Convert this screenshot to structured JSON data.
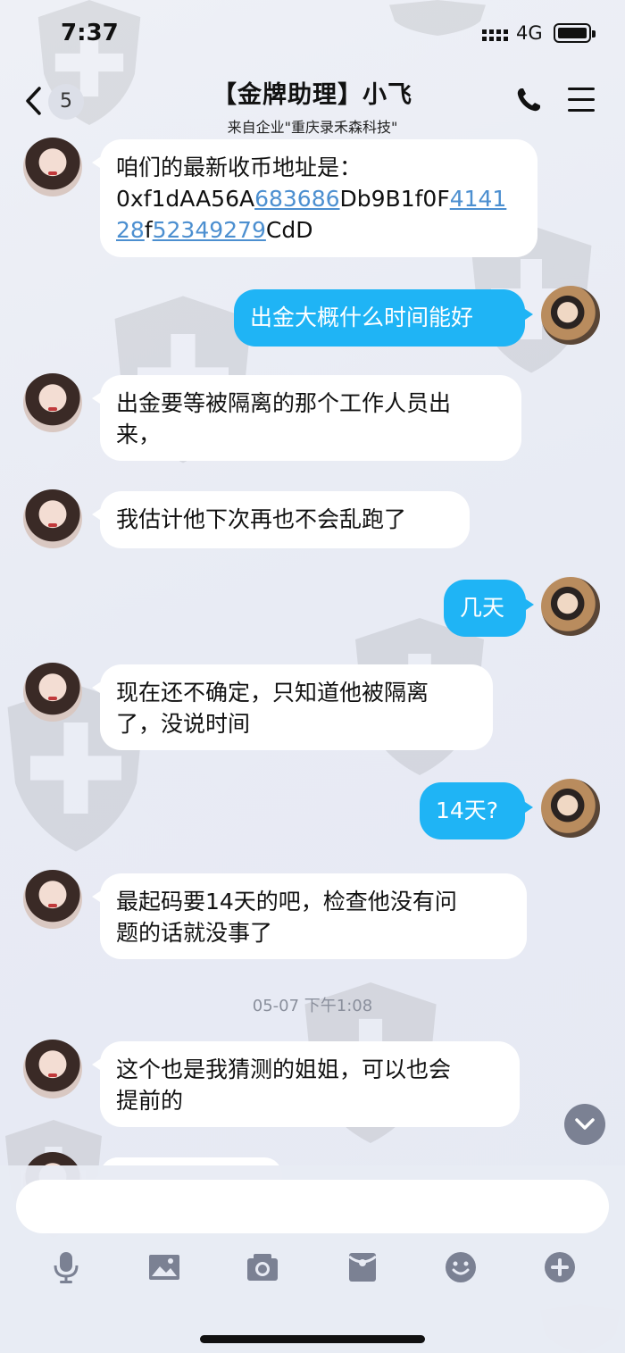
{
  "status_bar": {
    "time": "7:37",
    "network": "4G"
  },
  "header": {
    "unread_count": "5",
    "title": "【金牌助理】小飞",
    "subtitle": "来自企业\"重庆录禾森科技\""
  },
  "messages": [
    {
      "side": "in",
      "text_lines": [
        "咱们的最新收币地址是：",
        "",
        ""
      ],
      "address": {
        "p1": "0xf1dAA56A",
        "p2": "683686",
        "p3": "Db9B1f0F",
        "p4": "4141",
        "p5": "28",
        "p6": "f",
        "p7": "52349279",
        "p8": "CdD"
      }
    },
    {
      "side": "out",
      "text": "出金大概什么时间能好"
    },
    {
      "side": "in",
      "text_lines": [
        "出金要等被隔离的那个工作人员出",
        "来，"
      ]
    },
    {
      "side": "in",
      "text": "我估计他下次再也不会乱跑了"
    },
    {
      "side": "out",
      "text": "几天"
    },
    {
      "side": "in",
      "text_lines": [
        "现在还不确定，只知道他被隔离",
        "了，没说时间"
      ]
    },
    {
      "side": "out",
      "text": "14天?"
    },
    {
      "side": "in",
      "text_lines": [
        "最起码要14天的吧，检查他没有问",
        "题的话就没事了"
      ]
    },
    {
      "side": "in",
      "text_lines": [
        "这个也是我猜测的姐姐，可以也会",
        "提前的"
      ]
    }
  ],
  "timestamp": "05-07 下午1:08",
  "input": {
    "placeholder": ""
  },
  "toolbar": [
    "microphone-icon",
    "image-icon",
    "camera-icon",
    "red-packet-icon",
    "emoji-icon",
    "plus-icon"
  ],
  "colors": {
    "out_bubble": "#1fb4f5",
    "in_bubble": "#ffffff",
    "link": "#4c8fd0",
    "toolbar_icon": "#7b8193"
  }
}
